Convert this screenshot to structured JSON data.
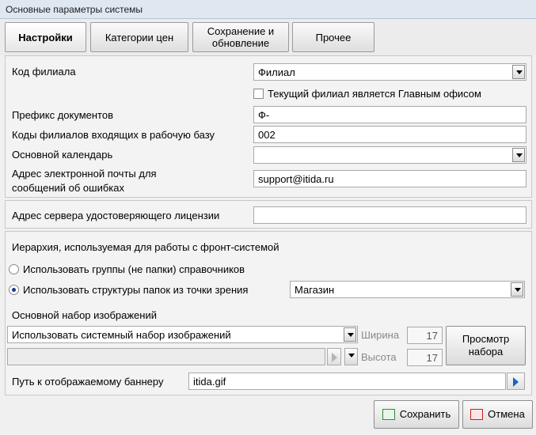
{
  "window": {
    "title": "Основные параметры системы"
  },
  "tabs": [
    "Настройки",
    "Категории цен",
    "Сохранение и обновление",
    "Прочее"
  ],
  "settings": {
    "branch_code_label": "Код филиала",
    "branch_code_value": "Филиал",
    "main_office_checkbox_label": "Текущий филиал является Главным офисом",
    "main_office_checked": false,
    "doc_prefix_label": "Префикс  документов",
    "doc_prefix_value": "Ф-",
    "branch_codes_label": "Коды филиалов входящих в рабочую базу",
    "branch_codes_value": "002",
    "calendar_label": "Основной календарь",
    "calendar_value": "",
    "email_label_line1": "Адрес электронной почты для",
    "email_label_line2": "сообщений об ошибках",
    "email_value": "support@itida.ru"
  },
  "license": {
    "server_label": "Адрес сервера удостоверяющего лицензии",
    "server_value": ""
  },
  "hierarchy": {
    "title": "Иерархия, используемая для работы с фронт-системой",
    "option_groups": "Использовать группы (не папки)  справочников",
    "option_folders": "Использовать структуры папок из точки зрения",
    "selected": "folders",
    "folders_value": "Магазин"
  },
  "images": {
    "title": "Основной набор изображений",
    "set_value": "Использовать системный набор изображений",
    "custom_value": "",
    "width_label": "Ширина",
    "width_value": "17",
    "height_label": "Высота",
    "height_value": "17",
    "preview_button": "Просмотр набора"
  },
  "banner": {
    "label": "Путь к отображаемому баннеру",
    "value": "itida.gif"
  },
  "footer": {
    "save_button": "Сохранить",
    "cancel_button": "Отмена"
  },
  "colors": {
    "accent_blue": "#1f5fc8",
    "save_green": "#2e8b3a",
    "cancel_red": "#c62020"
  }
}
